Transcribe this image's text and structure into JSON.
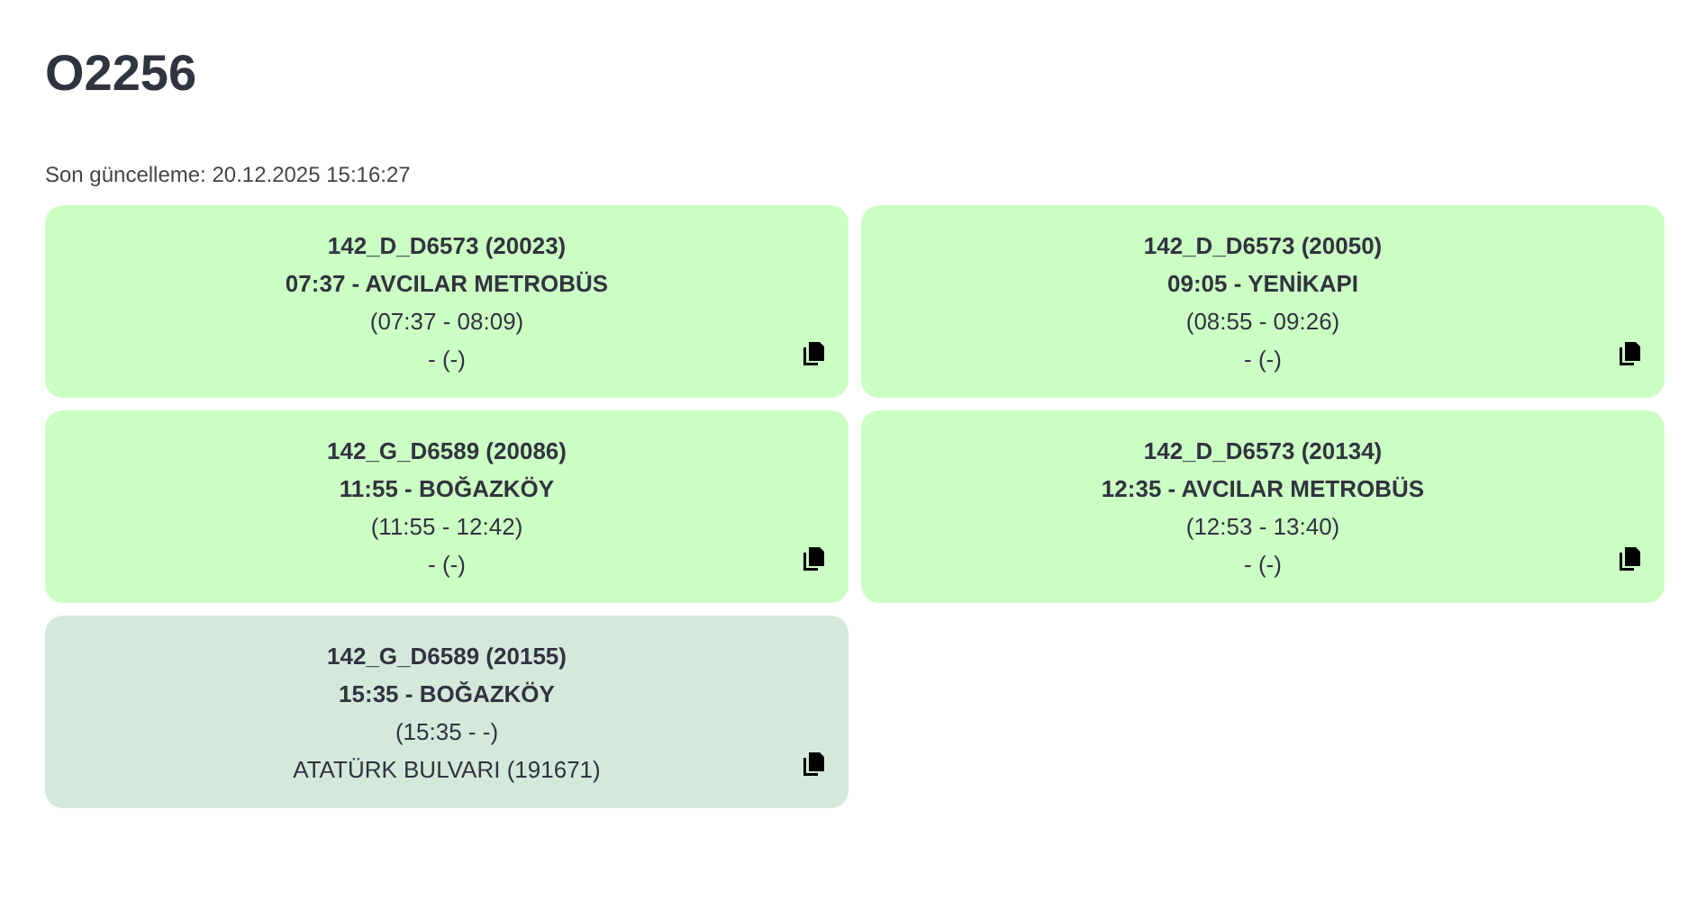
{
  "title": "O2256",
  "last_update": "Son güncelleme: 20.12.2025 15:16:27",
  "trips": [
    {
      "trip": "142_D_D6573 (20023)",
      "departure": "07:37 - AVCILAR METROBÜS",
      "window": "(07:37 - 08:09)",
      "stop": "- (-)",
      "color": "#ccffc4"
    },
    {
      "trip": "142_D_D6573 (20050)",
      "departure": "09:05 - YENİKAPI",
      "window": "(08:55 - 09:26)",
      "stop": "- (-)",
      "color": "#ccffc4"
    },
    {
      "trip": "142_G_D6589 (20086)",
      "departure": "11:55 - BOĞAZKÖY",
      "window": "(11:55 - 12:42)",
      "stop": "- (-)",
      "color": "#ccffc4"
    },
    {
      "trip": "142_D_D6573 (20134)",
      "departure": "12:35 - AVCILAR METROBÜS",
      "window": "(12:53 - 13:40)",
      "stop": "- (-)",
      "color": "#ccffc4"
    },
    {
      "trip": "142_G_D6589 (20155)",
      "departure": "15:35 - BOĞAZKÖY",
      "window": "(15:35 - -)",
      "stop": "ATATÜRK BULVARI (191671)",
      "color": "#d5e8dc"
    }
  ]
}
